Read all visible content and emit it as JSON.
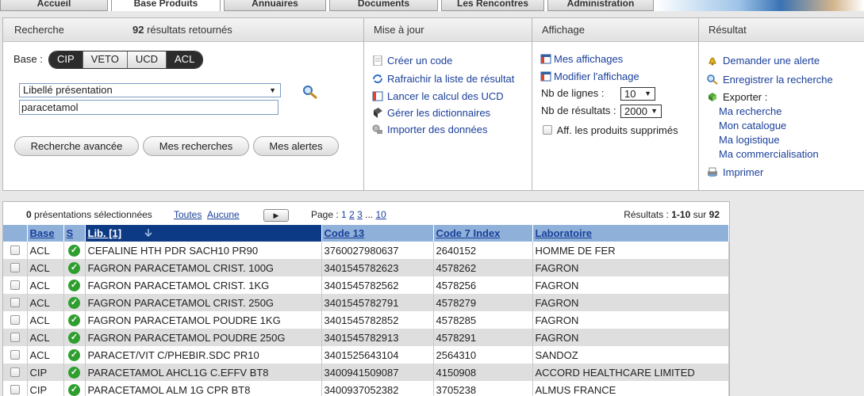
{
  "nav": {
    "tabs": [
      "Accueil",
      "Base Produits",
      "Annuaires",
      "Documents",
      "Les Rencontres",
      "Administration"
    ],
    "active": 1
  },
  "search": {
    "header_label": "Recherche",
    "count": "92",
    "count_suffix": "résultats retournés",
    "base_label": "Base :",
    "bases": [
      "CIP",
      "VETO",
      "UCD",
      "ACL"
    ],
    "bases_active": [
      "CIP",
      "ACL"
    ],
    "field_select": "Libellé présentation",
    "query": "paracetamol",
    "buttons": [
      "Recherche avancée",
      "Mes recherches",
      "Mes alertes"
    ]
  },
  "update": {
    "header": "Mise à jour",
    "items": [
      "Créer un code",
      "Rafraichir la liste de résultat",
      "Lancer le calcul des UCD",
      "Gérer les dictionnaires",
      "Importer des données"
    ]
  },
  "display": {
    "header": "Affichage",
    "links": [
      "Mes affichages",
      "Modifier l'affichage"
    ],
    "lines_label": "Nb de lignes :",
    "lines_value": "10",
    "results_label": "Nb de résultats :",
    "results_value": "2000",
    "deleted_label": "Aff. les produits supprimés"
  },
  "result": {
    "header": "Résultat",
    "alert": "Demander une alerte",
    "save": "Enregistrer la recherche",
    "export_label": "Exporter :",
    "export_items": [
      "Ma recherche",
      "Mon catalogue",
      "Ma logistique",
      "Ma commercialisation"
    ],
    "print": "Imprimer"
  },
  "list": {
    "selected_count": "0",
    "selected_suffix": "présentations sélectionnées",
    "all": "Toutes",
    "none": "Aucune",
    "page_label": "Page :",
    "pages": [
      "1",
      "2",
      "3"
    ],
    "ellipsis": "...",
    "last_page": "10",
    "results_label": "Résultats :",
    "results_range": "1-10",
    "results_of": "sur",
    "results_total": "92",
    "columns": [
      "Base",
      "S",
      "Lib. [1]",
      "Code 13",
      "Code 7 Index",
      "Laboratoire"
    ],
    "rows": [
      [
        "ACL",
        "CEFALINE HTH PDR SACH10 PR90",
        "3760027980637",
        "2640152",
        "HOMME DE FER"
      ],
      [
        "ACL",
        "FAGRON PARACETAMOL CRIST. 100G",
        "3401545782623",
        "4578262",
        "FAGRON"
      ],
      [
        "ACL",
        "FAGRON PARACETAMOL CRIST. 1KG",
        "3401545782562",
        "4578256",
        "FAGRON"
      ],
      [
        "ACL",
        "FAGRON PARACETAMOL CRIST. 250G",
        "3401545782791",
        "4578279",
        "FAGRON"
      ],
      [
        "ACL",
        "FAGRON PARACETAMOL POUDRE 1KG",
        "3401545782852",
        "4578285",
        "FAGRON"
      ],
      [
        "ACL",
        "FAGRON PARACETAMOL POUDRE 250G",
        "3401545782913",
        "4578291",
        "FAGRON"
      ],
      [
        "ACL",
        "PARACET/VIT C/PHEBIR.SDC PR10",
        "3401525643104",
        "2564310",
        "SANDOZ"
      ],
      [
        "CIP",
        "PARACETAMOL AHCL1G C.EFFV BT8",
        "3400941509087",
        "4150908",
        "ACCORD HEALTHCARE LIMITED"
      ],
      [
        "CIP",
        "PARACETAMOL ALM 1G CPR BT8",
        "3400937052382",
        "3705238",
        "ALMUS FRANCE"
      ]
    ]
  },
  "colors": {
    "header_blue": "#8fb1d9",
    "sorted_column": "#0d3a84",
    "link": "#1a3f9a",
    "status_ok": "#2e9e2e"
  },
  "icons": [
    "search-icon",
    "document-icon",
    "refresh-icon",
    "calc-icon",
    "dictionary-icon",
    "import-icon",
    "display-icon",
    "bell-icon",
    "save-search-icon",
    "export-icon",
    "print-icon",
    "check-icon",
    "sort-down-icon",
    "next-page-icon"
  ]
}
